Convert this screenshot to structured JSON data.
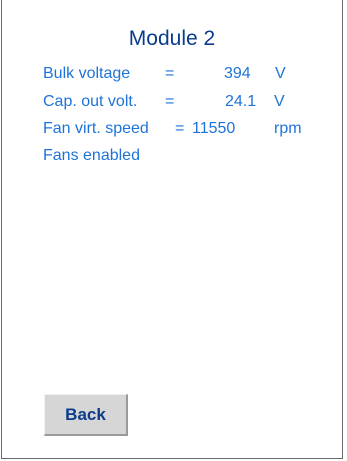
{
  "header": {
    "title": "Module 2"
  },
  "readings": [
    {
      "label": "Bulk voltage",
      "equals": "=",
      "value": "394",
      "unit": "V"
    },
    {
      "label": "Cap. out volt.",
      "equals": "=",
      "value": "24.1",
      "unit": "V"
    },
    {
      "label": "Fan virt. speed",
      "equals": "=",
      "value": "11550",
      "unit": "rpm"
    }
  ],
  "status": {
    "fans": "Fans enabled"
  },
  "footer": {
    "back_label": "Back"
  },
  "colors": {
    "title": "#0b3c8c",
    "text": "#1e73d8",
    "button_bg": "#d6d6d6"
  }
}
